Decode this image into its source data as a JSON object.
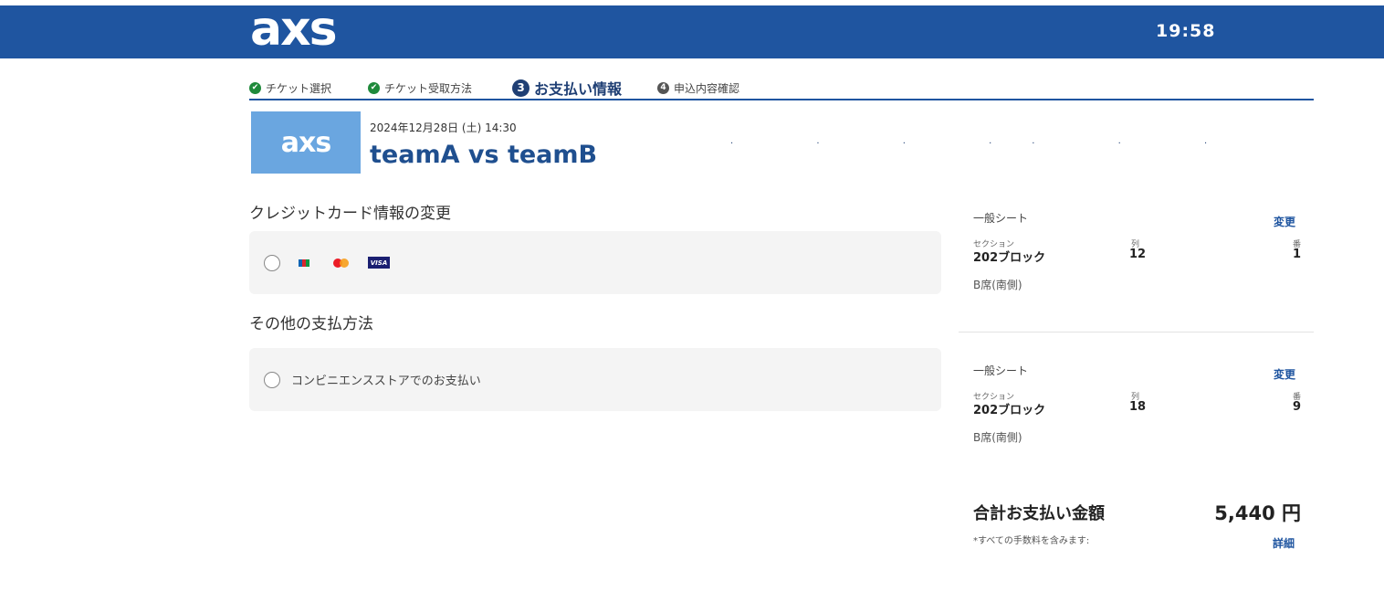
{
  "header": {
    "logo": "axs",
    "timer": "19:58"
  },
  "steps": [
    {
      "label": "チケット選択",
      "badge": "✔",
      "state": "done"
    },
    {
      "label": "チケット受取方法",
      "badge": "✔",
      "state": "done"
    },
    {
      "label": "お支払い情報",
      "badge": "3",
      "state": "active"
    },
    {
      "label": "申込内容確認",
      "badge": "4",
      "state": "pending"
    }
  ],
  "event": {
    "logo": "axs",
    "date": "2024年12月28日 (土) 14:30",
    "title": "teamA vs teamB"
  },
  "payment": {
    "credit_title": "クレジットカード情報の変更",
    "card_icons": [
      "jcb-icon",
      "mastercard-icon",
      "visa-icon"
    ],
    "visa_text": "VISA",
    "other_title": "その他の支払方法",
    "convenience_label": "コンビニエンスストアでのお支払い"
  },
  "tickets": [
    {
      "type": "一般シート",
      "change": "変更",
      "section_label": "セクション",
      "section": "202ブロック",
      "row_label": "列",
      "row": "12",
      "seat_label": "番",
      "seat": "1",
      "sub": "B席(南側)"
    },
    {
      "type": "一般シート",
      "change": "変更",
      "section_label": "セクション",
      "section": "202ブロック",
      "row_label": "列",
      "row": "18",
      "seat_label": "番",
      "seat": "9",
      "sub": "B席(南側)"
    }
  ],
  "total": {
    "label": "合計お支払い金額",
    "amount": "5,440 円",
    "note": "*すべての手数料を含みます:",
    "detail": "詳細"
  },
  "colors": {
    "brand": "#1f55a0",
    "done": "#1f8a3b",
    "active": "#1f3f74"
  }
}
